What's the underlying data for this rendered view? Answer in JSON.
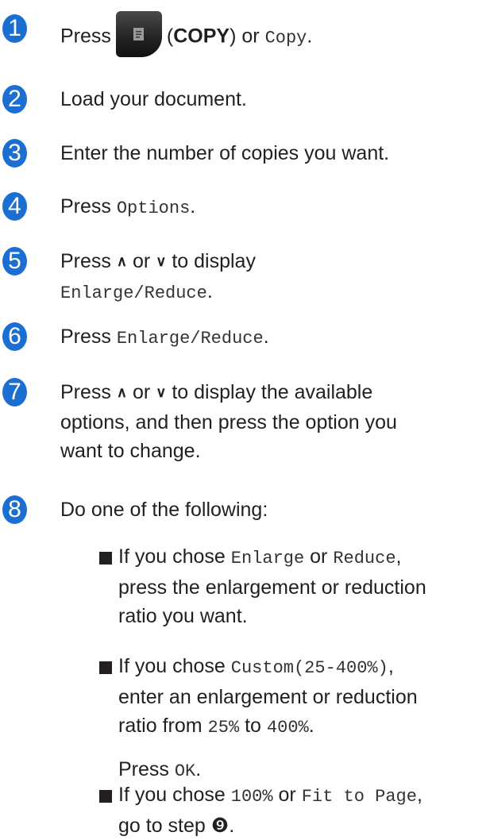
{
  "steps": [
    {
      "num": "1",
      "press": "Press",
      "paren_open": "(",
      "copy_key": "COPY",
      "paren_close": ")",
      "or": "or",
      "copy_mono": "Copy",
      "period": "."
    },
    {
      "num": "2",
      "text": "Load your document."
    },
    {
      "num": "3",
      "text": "Enter the number of copies you want."
    },
    {
      "num": "4",
      "press": "Press",
      "mono": "Options",
      "period": "."
    },
    {
      "num": "5",
      "line1_a": "Press",
      "up": "∧",
      "or": "or",
      "down": "∨",
      "line1_b": "to display",
      "mono": "Enlarge/Reduce",
      "period": "."
    },
    {
      "num": "6",
      "press": "Press",
      "mono": "Enlarge/Reduce",
      "period": "."
    },
    {
      "num": "7",
      "line1_a": "Press",
      "up": "∧",
      "or": "or",
      "down": "∨",
      "line1_b": "to display the available",
      "line2": "options, and then press the option you",
      "line3": "want to change."
    },
    {
      "num": "8",
      "text": "Do one of the following:"
    }
  ],
  "bullets": [
    {
      "a": "If you chose",
      "m1": "Enlarge",
      "or": "or",
      "m2": "Reduce",
      "comma": ",",
      "l2": "press the enlargement or reduction",
      "l3": "ratio you want."
    },
    {
      "a": "If you chose",
      "m1": "Custom(25-400%)",
      "comma": ",",
      "l2": "enter an enlargement or reduction",
      "l3a": "ratio from",
      "m2": "25%",
      "to": "to",
      "m3": "400%",
      "period": ".",
      "press": "Press",
      "ok": "OK",
      "period2": "."
    },
    {
      "a": "If you chose",
      "m1": "100%",
      "or": "or",
      "m2": "Fit to Page",
      "comma": ",",
      "l2": "go to step",
      "ref": "❾",
      "period": "."
    }
  ]
}
